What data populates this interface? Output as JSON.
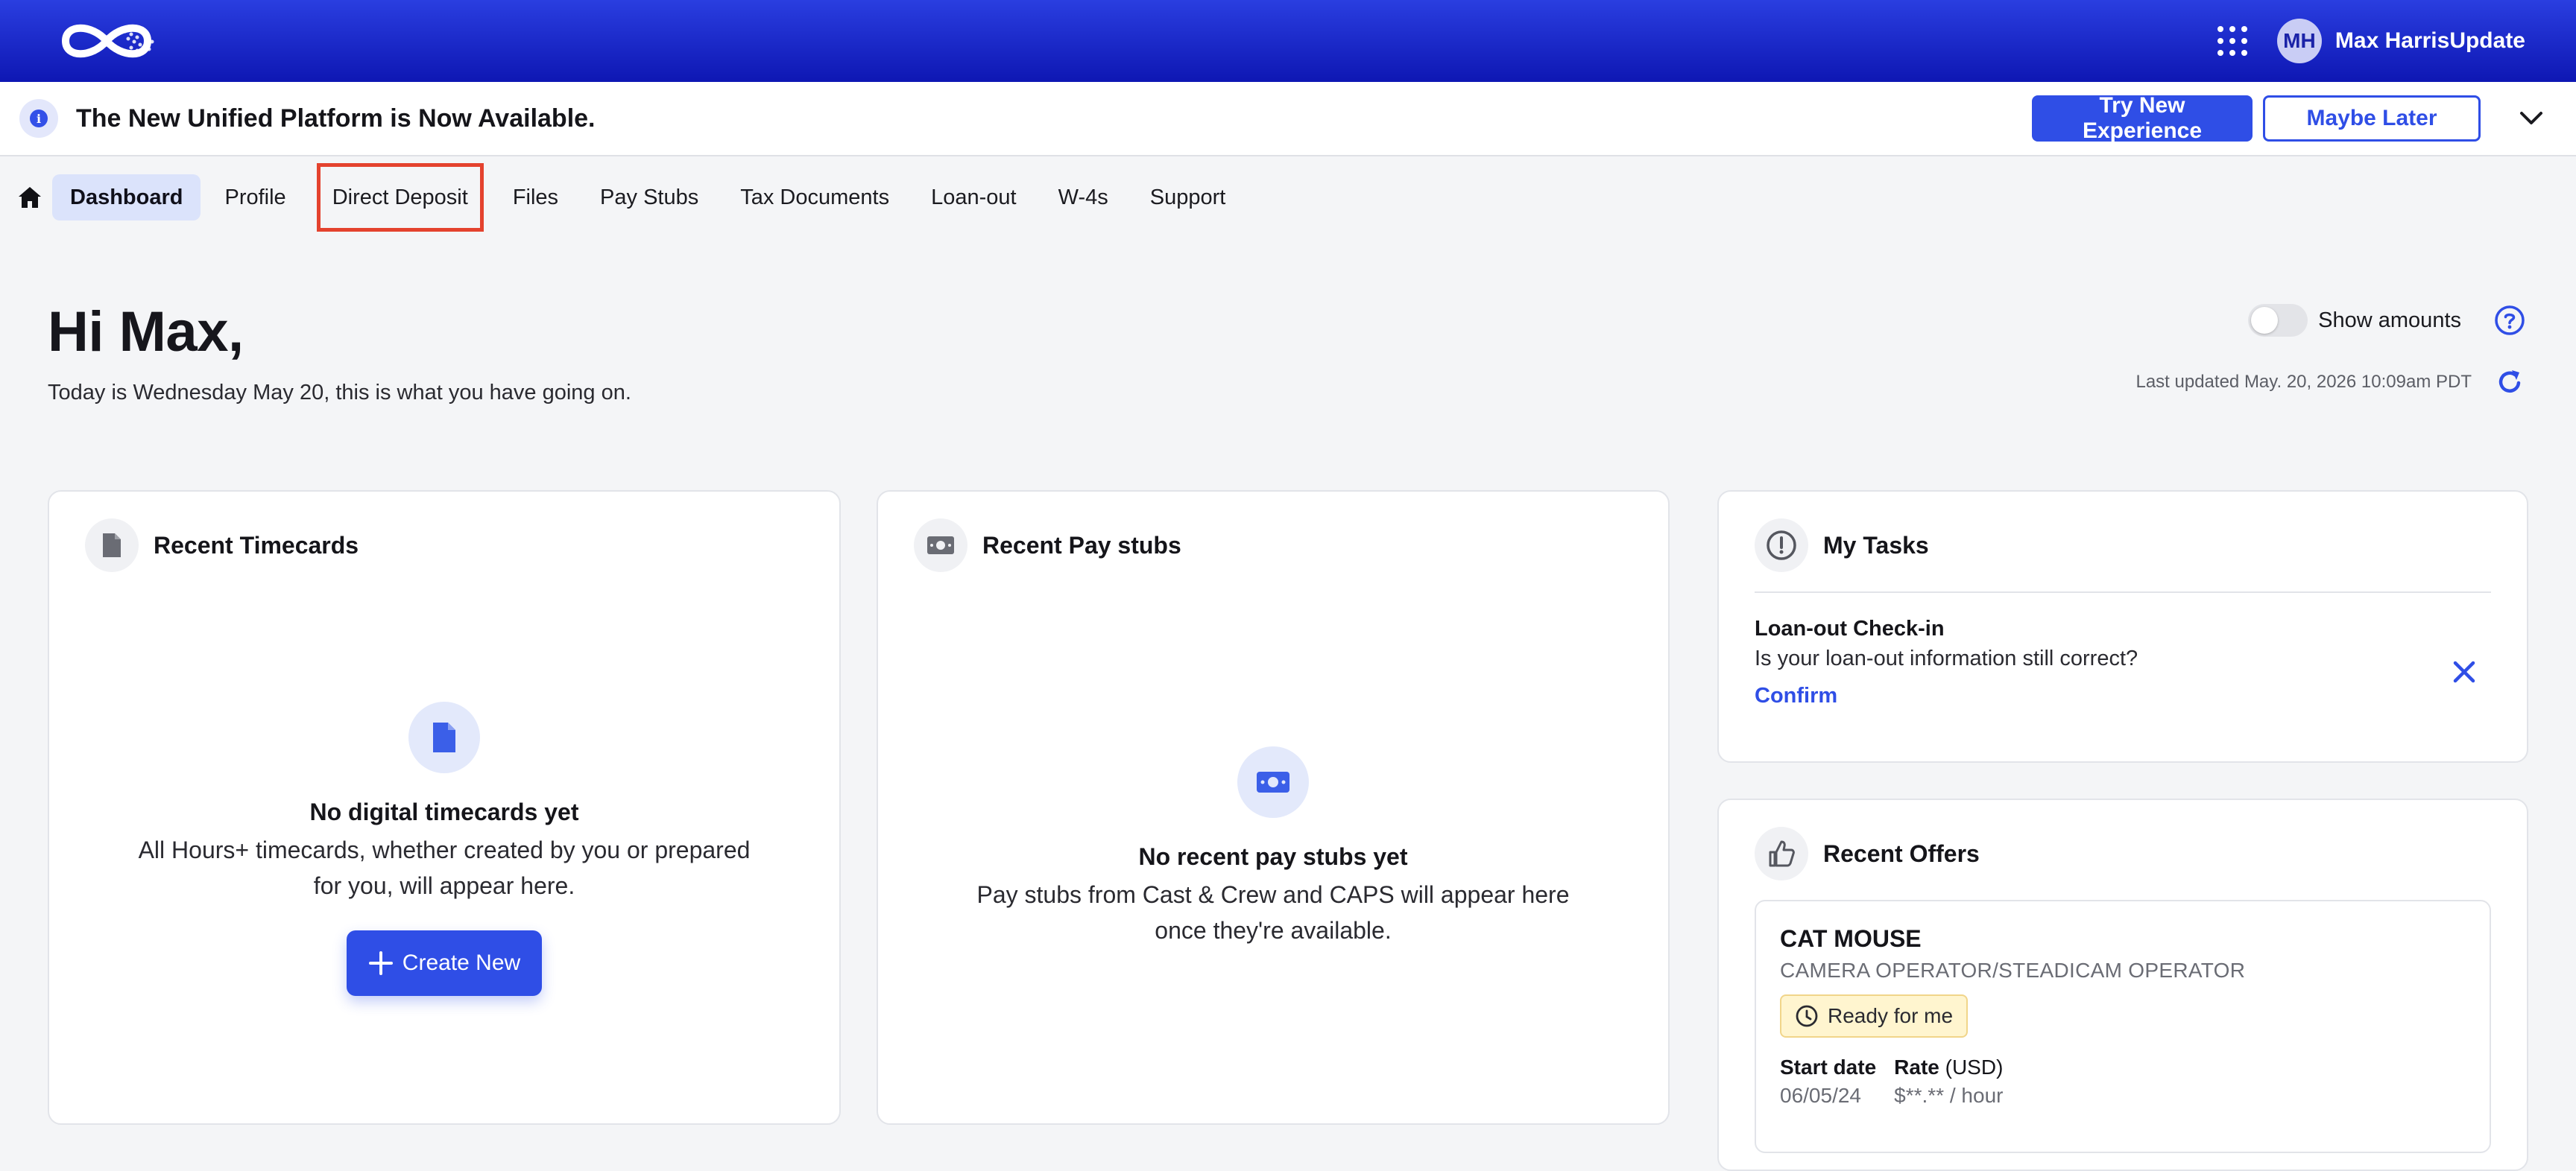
{
  "header": {
    "user_initials": "MH",
    "user_name": "Max HarrisUpdate"
  },
  "banner": {
    "text": "The New Unified Platform is Now Available.",
    "try_label": "Try New Experience",
    "later_label": "Maybe Later"
  },
  "nav": {
    "items": [
      {
        "label": "Dashboard"
      },
      {
        "label": "Profile"
      },
      {
        "label": "Direct Deposit"
      },
      {
        "label": "Files"
      },
      {
        "label": "Pay Stubs"
      },
      {
        "label": "Tax Documents"
      },
      {
        "label": "Loan-out"
      },
      {
        "label": "W-4s"
      },
      {
        "label": "Support"
      }
    ]
  },
  "greeting": {
    "title": "Hi Max,",
    "subtitle": "Today is Wednesday May 20, this is what you have going on."
  },
  "controls": {
    "show_amounts": "Show amounts",
    "last_updated": "Last updated May. 20, 2026 10:09am PDT"
  },
  "timecards": {
    "title": "Recent Timecards",
    "empty_title": "No digital timecards yet",
    "empty_line1": "All Hours+ timecards, whether created by you or prepared",
    "empty_line2": "for you, will appear here.",
    "create_label": "Create New"
  },
  "paystubs": {
    "title": "Recent Pay stubs",
    "empty_title": "No recent pay stubs yet",
    "empty_line1": "Pay stubs from Cast & Crew and CAPS will appear here",
    "empty_line2": "once they're available."
  },
  "tasks": {
    "title": "My Tasks",
    "task_title": "Loan-out Check-in",
    "task_desc": "Is your loan-out information still correct?",
    "task_link": "Confirm"
  },
  "offers": {
    "title": "Recent Offers",
    "offer_title": "CAT MOUSE",
    "offer_role": "CAMERA OPERATOR/STEADICAM OPERATOR",
    "badge": "Ready for me",
    "start_label": "Start date",
    "start_value": "06/05/24",
    "rate_label": "Rate",
    "rate_unit": "(USD)",
    "rate_value": "$**.** / hour"
  }
}
